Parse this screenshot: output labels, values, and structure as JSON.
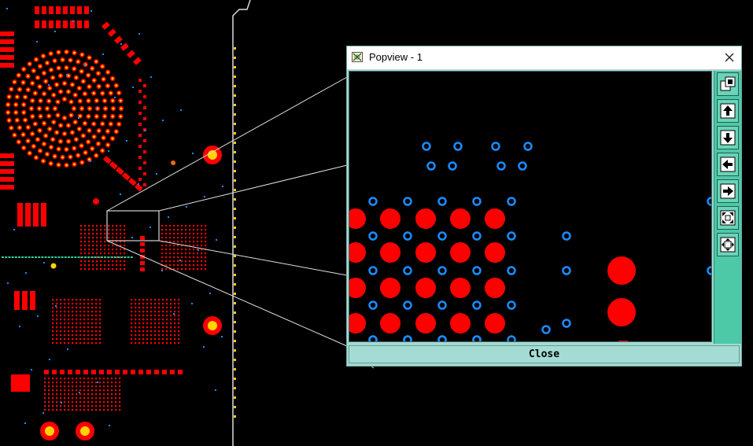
{
  "popup": {
    "title": "Popview - 1",
    "close_button_label": "Close"
  },
  "toolbar": [
    {
      "icon": "layers-icon"
    },
    {
      "icon": "move-up-icon"
    },
    {
      "icon": "move-down-icon"
    },
    {
      "icon": "move-left-icon"
    },
    {
      "icon": "move-right-icon"
    },
    {
      "icon": "zoom-fit-icon"
    },
    {
      "icon": "zoom-window-icon"
    }
  ],
  "colors": {
    "background": "#000000",
    "pad_red": "#ff0000",
    "pad_yellow": "#ffd400",
    "via_blue": "#1a8cff",
    "outline": "#ffffff",
    "dialog_bg": "#a5d9d1",
    "toolbar_bg": "#4ec9a8"
  }
}
